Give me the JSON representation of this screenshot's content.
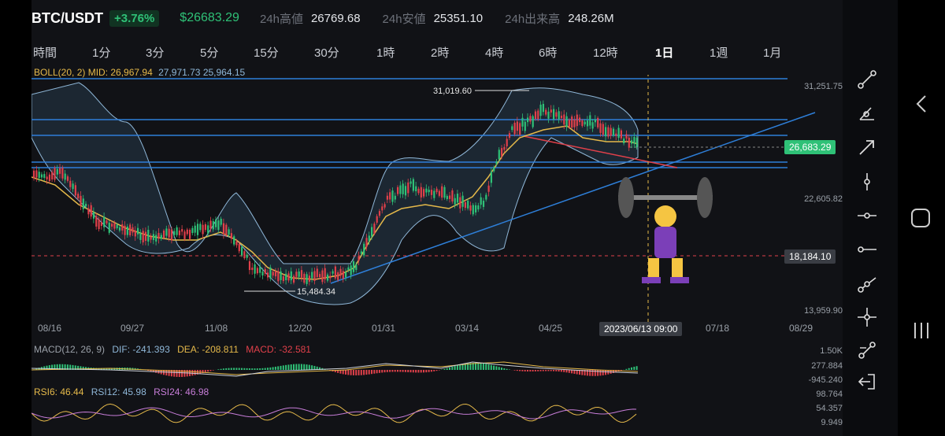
{
  "header": {
    "symbol": "BTC/USDT",
    "change_pct": "+3.76%",
    "last_price": "$26683.29",
    "high_label": "24h高値",
    "high_value": "26769.68",
    "low_label": "24h安値",
    "low_value": "25351.10",
    "vol_label": "24h出来高",
    "vol_value": "248.26M"
  },
  "timeframes": [
    "時間",
    "1分",
    "3分",
    "5分",
    "15分",
    "30分",
    "1時",
    "2時",
    "4時",
    "6時",
    "12時",
    "1日",
    "1週",
    "1月"
  ],
  "active_timeframe": "1日",
  "indicators": {
    "boll": {
      "label": "BOLL(20, 2) MID: 26,967.94",
      "up": "27,971.73",
      "low": "25,964.15"
    },
    "macd": {
      "label": "MACD(12, 26, 9)",
      "dif": "DIF: -241.393",
      "dea": "DEA: -208.811",
      "macd": "MACD: -32.581"
    },
    "rsi": {
      "r6": "RSI6: 46.44",
      "r12": "RSI12: 45.98",
      "r24": "RSI24: 46.98"
    }
  },
  "price_axis": [
    "31,251.75",
    "22,605.82",
    "13,959.90"
  ],
  "price_badges": {
    "current": "26,683.29",
    "dashed": "18,184.10"
  },
  "annotations": {
    "high": "31,019.60",
    "low": "15,484.34"
  },
  "x_axis": [
    "08/16",
    "09/27",
    "11/08",
    "12/20",
    "01/31",
    "03/14",
    "04/25",
    "07/18",
    "08/29"
  ],
  "crosshair_date": "2023/06/13 09:00",
  "macd_axis": [
    "1.50K",
    "277.884",
    "-945.240"
  ],
  "rsi_axis": [
    "98.764",
    "54.357",
    "9.949"
  ],
  "colors": {
    "up": "#2fc177",
    "down": "#e0404a",
    "accent_line": "#2e7fd9",
    "mid": "#e5b94a"
  }
}
